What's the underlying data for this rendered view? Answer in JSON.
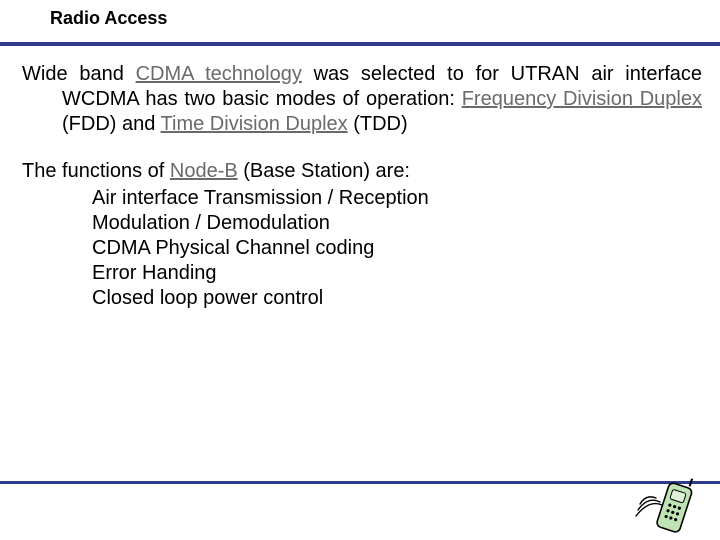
{
  "title": "Radio Access",
  "para1": {
    "pre": "Wide band ",
    "link1": "CDMA technology",
    "mid1": " was selected to for UTRAN air interface WCDMA has two basic modes of operation: ",
    "link2": "Frequency Division Duplex",
    "mid2": " (FDD) and ",
    "link3": "Time Division Duplex",
    "post": " (TDD)"
  },
  "para2": {
    "pre": "The functions of ",
    "link": "Node-B",
    "post": " (Base Station) are:"
  },
  "functions": [
    "Air interface Transmission / Reception",
    "Modulation / Demodulation",
    "CDMA Physical Channel coding",
    "Error Handing",
    "Closed loop power control"
  ],
  "colors": {
    "rule": "#2e3a8c",
    "link": "#6a6a6a"
  },
  "icon": "phone-icon"
}
